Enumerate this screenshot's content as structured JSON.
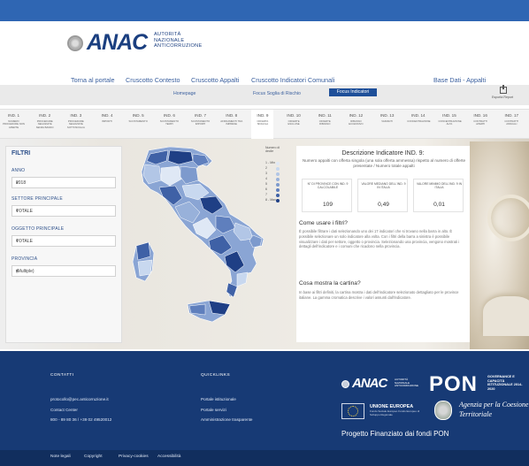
{
  "header": {
    "logo_text": "ANAC",
    "logo_sub": [
      "AUTORITÀ",
      "NAZIONALE",
      "ANTICORRUZIONE"
    ]
  },
  "nav": {
    "items": [
      {
        "label": "Torna al portale"
      },
      {
        "label": "Cruscotto Contesto"
      },
      {
        "label": "Cruscotto Appalti"
      },
      {
        "label": "Cruscotto Indicatori Comunali"
      },
      {
        "label": "Base Dati - Appalti"
      }
    ],
    "active": "Cruscotto Appalti"
  },
  "subnav": {
    "items": [
      {
        "label": "Homepage"
      },
      {
        "label": "Focus Soglia di Rischio"
      },
      {
        "label": "Focus Indicatori"
      }
    ],
    "active": "Focus Indicatori",
    "export_label": "Esporta Report"
  },
  "indicators": [
    {
      "code": "IND. 1",
      "name": "NUMERO PROCEDURE NON APERTE"
    },
    {
      "code": "IND. 2",
      "name": "PROCEDURE NEGOZIATE SENZA BANDO"
    },
    {
      "code": "IND. 3",
      "name": "PROCEDURE NEGOZIATE SOTTOSOGLIA"
    },
    {
      "code": "IND. 4",
      "name": "IMPORTI"
    },
    {
      "code": "IND. 5",
      "name": "SCOSTAMENTO"
    },
    {
      "code": "IND. 6",
      "name": "SCOSTAMENTO TEMPI"
    },
    {
      "code": "IND. 7",
      "name": "SCOSTAMENTO IMPORTI"
    },
    {
      "code": "IND. 8",
      "name": "AFFIDAMENTI TRA IMPRESE"
    },
    {
      "code": "IND. 9",
      "name": "OFFERTA SINGOLA"
    },
    {
      "code": "IND. 10",
      "name": "OFFERTE ESCLUSE"
    },
    {
      "code": "IND. 11",
      "name": "OFFERTE RIBASSO"
    },
    {
      "code": "IND. 12",
      "name": "RIBASSO ECCESSIVO"
    },
    {
      "code": "IND. 13",
      "name": "VARIANTI"
    },
    {
      "code": "IND. 14",
      "name": "CONCENTRAZIONE"
    },
    {
      "code": "IND. 15",
      "name": "CONCENTRAZIONE ALTA"
    },
    {
      "code": "IND. 16",
      "name": "CONTRATTI APERTI"
    },
    {
      "code": "IND. 17",
      "name": "CONTRATTI ANNUALI"
    }
  ],
  "active_indicator": "IND. 9",
  "filters": {
    "title": "FILTRI",
    "anno_label": "ANNO",
    "anno_value": "2018",
    "settore_label": "SETTORE PRINCIPALE",
    "settore_value": "TOTALE",
    "oggetto_label": "OGGETTO PRINCIPALE",
    "oggetto_value": "TOTALE",
    "provincia_label": "PROVINCIA",
    "provincia_value": "(Multiple)"
  },
  "map": {
    "legend_title": "Numero di decile",
    "legend": [
      {
        "label": "1 - Min",
        "color": "#dfe8f5"
      },
      {
        "label": "2",
        "color": "#c8d8ef"
      },
      {
        "label": "3",
        "color": "#b2c6e6"
      },
      {
        "label": "4",
        "color": "#98b1da"
      },
      {
        "label": "5",
        "color": "#7d9acd"
      },
      {
        "label": "6",
        "color": "#5f7fbd"
      },
      {
        "label": "7",
        "color": "#3f61a6"
      },
      {
        "label": "8 - Max",
        "color": "#1f3f85"
      }
    ]
  },
  "panel": {
    "title": "Descrizione Indicatore IND. 9:",
    "description": "Numero appalti con offerta singola (una sola offerta ammessa) rispetto al numero di offerte presentate / Numero totale appalti",
    "stats": [
      {
        "label": "N° DI PROVINCE CON IND. 9 CALCOLABILE",
        "value": "109"
      },
      {
        "label": "VALORE MEDIANO DELL'IND. 9 IN ITALIA",
        "value": "0,49"
      },
      {
        "label": "VALORE MINIMO DELL'IND. 9 IN ITALIA",
        "value": "0,01"
      }
    ],
    "howto_title": "Come usare i filtri?",
    "howto_text": "È possibile filtrare i dati selezionando uno dei 17 indicatori che si trovano nella barra in alto. È possibile selezionare un solo indicatore alla volta. Con i filtri della barra a sinistra è possibile visualizzare i dati per settore, oggetto o provincia. Selezionando una provincia, vengono mostrati i dettagli dell'indicatore e i comuni che ricadono nella provincia.",
    "map_title": "Cosa mostra la cartina?",
    "map_text": "In base ai filtri definiti, la cartina mostra i dati dell'indicatore selezionato dettagliato per le province italiane. La gamma cromatica descrive i valori assunti dall'indicatore."
  },
  "footer": {
    "contacts_heading": "CONTATTI",
    "contacts": [
      "protocollo@pec.anticorruzione.it",
      "Contact Center",
      "800 - 89 80 36 / +39 02 49520012"
    ],
    "links_heading": "QUICKLINKS",
    "links": [
      "Portale istituzionale",
      "Portale servizi",
      "Amministrazione trasparente"
    ],
    "anac_text": "ANAC",
    "anac_sub": "AUTORITÀ NAZIONALE ANTICORRUZIONE",
    "pon_text": "PON",
    "pon_sub": "GOVERNANCE E CAPACITÀ ISTITUZIONALE 2014-2020",
    "eu_title": "UNIONE EUROPEA",
    "eu_sub": "Fondo Sociale Europeo Fondo Europeo di Sviluppo Regionale",
    "agency": "Agenzia per la Coesione Territoriale",
    "funded": "Progetto Finanziato dai fondi PON"
  },
  "bottom": {
    "links": [
      "Note legali",
      "Copyright",
      "Privacy-cookies",
      "Accessibilità"
    ]
  }
}
